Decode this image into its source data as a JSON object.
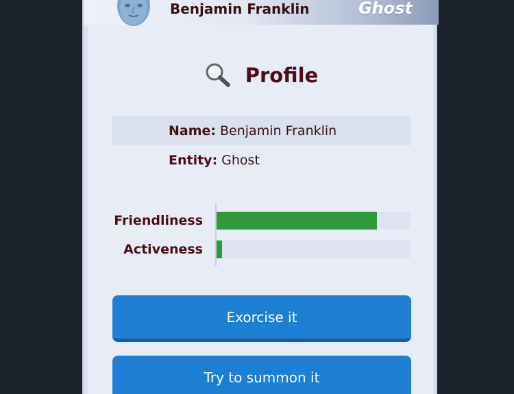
{
  "header": {
    "name": "Benjamin Franklin",
    "type_label": "Ghost"
  },
  "profile": {
    "title": "Profile",
    "name_label": "Name:",
    "name_value": "Benjamin Franklin",
    "entity_label": "Entity:",
    "entity_value": "Ghost"
  },
  "stats": [
    {
      "label": "Friendliness",
      "fraction": 0.83
    },
    {
      "label": "Activeness",
      "fraction": 0.03
    }
  ],
  "actions": {
    "exorcise_label": "Exorcise it",
    "summon_label": "Try to summon it"
  },
  "colors": {
    "accent_button": "#1c7fd4",
    "bar_fill": "#2e9a3c",
    "title_text": "#4a0d14"
  }
}
